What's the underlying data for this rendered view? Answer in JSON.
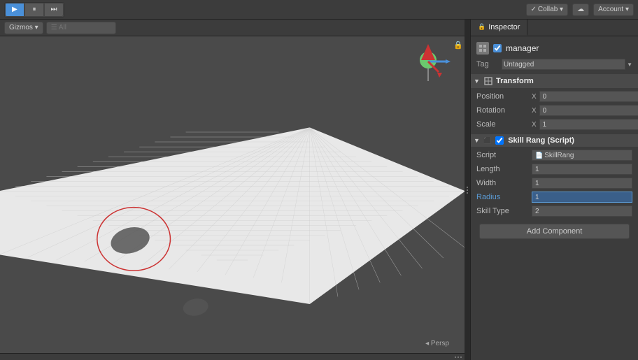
{
  "toolbar": {
    "play_label": "▶",
    "pause_label": "⏸",
    "step_label": "⏭",
    "collab_label": "Collab ▾",
    "cloud_label": "☁",
    "account_label": "Account ▾"
  },
  "scene": {
    "gizmos_label": "Gizmos ▾",
    "search_placeholder": "☰ All",
    "persp_label": "◂ Persp"
  },
  "inspector": {
    "tab_label": "Inspector",
    "tab_icon": "i",
    "object_name": "manager",
    "tag_label": "Tag",
    "tag_value": "Untagged",
    "transform": {
      "title": "Transform",
      "position_label": "Position",
      "position_axis": "X",
      "position_value": "0",
      "rotation_label": "Rotation",
      "rotation_axis": "X",
      "rotation_value": "0",
      "scale_label": "Scale",
      "scale_axis": "X",
      "scale_value": "1"
    },
    "skill_rang": {
      "title": "Skill Rang (Script)",
      "script_label": "Script",
      "script_value": "SkillRang",
      "length_label": "Length",
      "length_value": "1",
      "width_label": "Width",
      "width_value": "1",
      "radius_label": "Radius",
      "radius_value": "1",
      "skill_type_label": "Skill Type",
      "skill_type_value": "2"
    },
    "add_component_label": "Add Component"
  }
}
